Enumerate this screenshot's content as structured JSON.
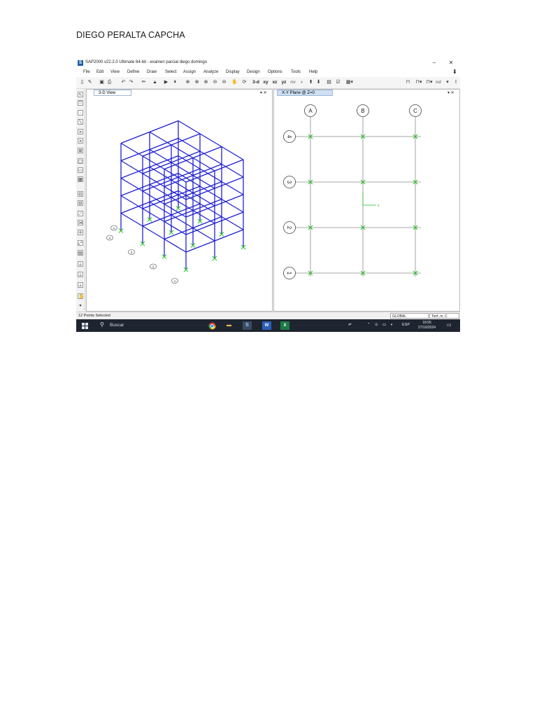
{
  "document": {
    "heading": "DIEGO PERALTA CAPCHA"
  },
  "app": {
    "title": "SAP2000 v22.2.0 Ultimate 64-bit - examen parcial diego domingo",
    "icon_letter": "S",
    "window_controls": {
      "minimize": "–",
      "restore": "⧉",
      "close": "✕"
    },
    "menu": [
      "File",
      "Edit",
      "View",
      "Define",
      "Draw",
      "Select",
      "Assign",
      "Analyze",
      "Display",
      "Design",
      "Options",
      "Tools",
      "Help"
    ],
    "toolbar_text": {
      "view_3d": "3-d",
      "view_xy": "xy",
      "view_xz": "xz",
      "view_yz": "yz",
      "view_nv": "nv",
      "view_nd": "nd"
    }
  },
  "panes": {
    "left": {
      "tab": "3-D View",
      "controls": "▾ ✕"
    },
    "right": {
      "tab": "X-Y Plane @ Z=0",
      "controls": "▾ ✕"
    }
  },
  "plan_view": {
    "column_labels": [
      "A",
      "B",
      "C"
    ],
    "row_labels": [
      "4",
      "3",
      "2",
      "1"
    ],
    "axis_x_label": "x"
  },
  "model_view": {
    "grid_bubbles": [
      "1",
      "2",
      "3",
      "4",
      "A"
    ]
  },
  "status": {
    "selection": "12 Points Selected",
    "coordinate_system": "GLOBAL",
    "units": "Tonf, m, C"
  },
  "taskbar": {
    "search_placeholder": "Buscar",
    "language": "ESP",
    "time": "18:55",
    "date": "27/10/2024"
  },
  "colors": {
    "frame": "#1f1fd6",
    "restraint": "#19c019",
    "taskbar": "#1f2530",
    "tab_active": "#cfe0f3"
  }
}
